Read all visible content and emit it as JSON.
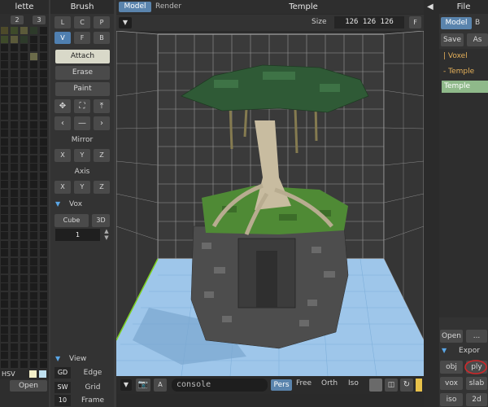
{
  "palette": {
    "title": "lette",
    "tabs": [
      "2",
      "3"
    ],
    "hsv_label": "HSV",
    "open_label": "Open",
    "swatch_colors": [
      "#4d4a2a",
      "#3e4a2a",
      "#5b5a3a",
      "#2d3a2a",
      "#6b6b4a",
      "#cfcf9e",
      "#ffffff",
      "#a9c9d9"
    ]
  },
  "brush": {
    "title": "Brush",
    "modes_row1": [
      "L",
      "C",
      "P"
    ],
    "modes_row2": [
      "V",
      "F",
      "B"
    ],
    "actions": [
      "Attach",
      "Erase",
      "Paint"
    ],
    "mirror_label": "Mirror",
    "mirror_axes": [
      "X",
      "Y",
      "Z"
    ],
    "axis_label": "Axis",
    "axis_axes": [
      "X",
      "Y",
      "Z"
    ],
    "vox_label": "Vox",
    "cube_label": "Cube",
    "threed_label": "3D",
    "size_value": "1",
    "view_label": "View",
    "view_rows": [
      {
        "key": "GD",
        "label": "Edge"
      },
      {
        "key": "SW",
        "label": "Grid"
      },
      {
        "key": "10",
        "label": "Frame"
      }
    ]
  },
  "viewport": {
    "tabs": [
      "Model",
      "Render"
    ],
    "title": "Temple",
    "size_label": "Size",
    "size_values": "126 126 126",
    "f_label": "F",
    "a_label": "A",
    "console_placeholder": "console",
    "projection_modes": [
      "Pers",
      "Free",
      "Orth",
      "Iso"
    ],
    "active_projection": "Pers"
  },
  "right_panel": {
    "title": "File",
    "tabs": [
      "Model",
      "B"
    ],
    "save_label": "Save",
    "as_label": "As",
    "tree_items": [
      {
        "prefix": "|",
        "label": "Voxel",
        "color": "#e6b15a"
      },
      {
        "prefix": "-",
        "label": "Temple",
        "color": "#e6b15a"
      },
      {
        "prefix": "",
        "label": "Temple",
        "color": "#ffffff"
      }
    ],
    "open_label": "Open",
    "more_label": "...",
    "export_label": "Expor",
    "export_formats": [
      "obj",
      "ply",
      "vox",
      "slab",
      "iso",
      "2d"
    ]
  }
}
